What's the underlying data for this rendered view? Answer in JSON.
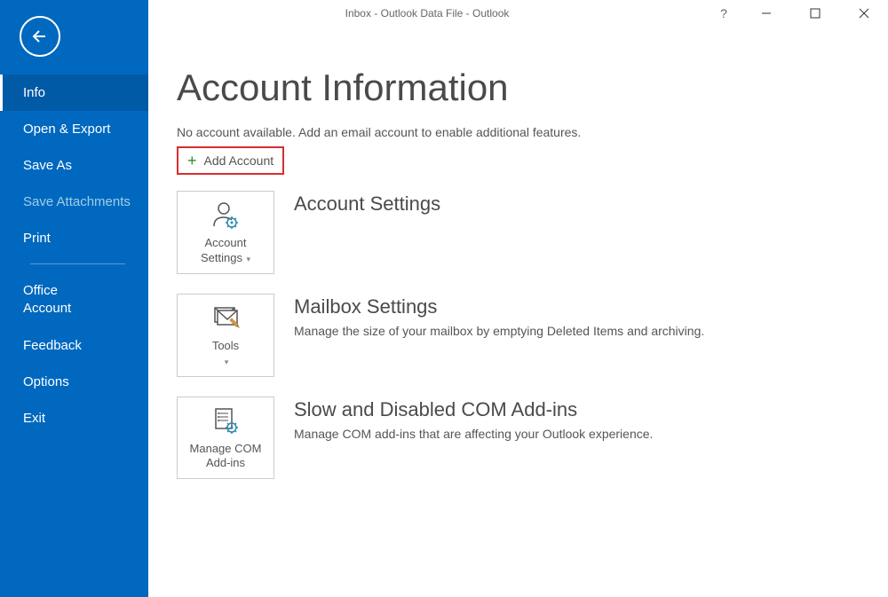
{
  "window": {
    "title": "Inbox - Outlook Data File  -  Outlook"
  },
  "sidebar": {
    "items": [
      {
        "label": "Info",
        "state": "selected"
      },
      {
        "label": "Open & Export",
        "state": "normal"
      },
      {
        "label": "Save As",
        "state": "normal"
      },
      {
        "label": "Save Attachments",
        "state": "disabled"
      },
      {
        "label": "Print",
        "state": "normal"
      }
    ],
    "items2": [
      {
        "label": "Office Account"
      },
      {
        "label": "Feedback"
      },
      {
        "label": "Options"
      },
      {
        "label": "Exit"
      }
    ]
  },
  "main": {
    "page_title": "Account Information",
    "subtext": "No account available. Add an email account to enable additional features.",
    "add_account_label": "Add Account",
    "sections": [
      {
        "tile_label": "Account Settings",
        "tile_has_caret": true,
        "title": "Account Settings",
        "desc": ""
      },
      {
        "tile_label": "Tools",
        "tile_has_caret": true,
        "title": "Mailbox Settings",
        "desc": "Manage the size of your mailbox by emptying Deleted Items and archiving."
      },
      {
        "tile_label": "Manage COM Add-ins",
        "tile_has_caret": false,
        "title": "Slow and Disabled COM Add-ins",
        "desc": "Manage COM add-ins that are affecting your Outlook experience."
      }
    ]
  }
}
